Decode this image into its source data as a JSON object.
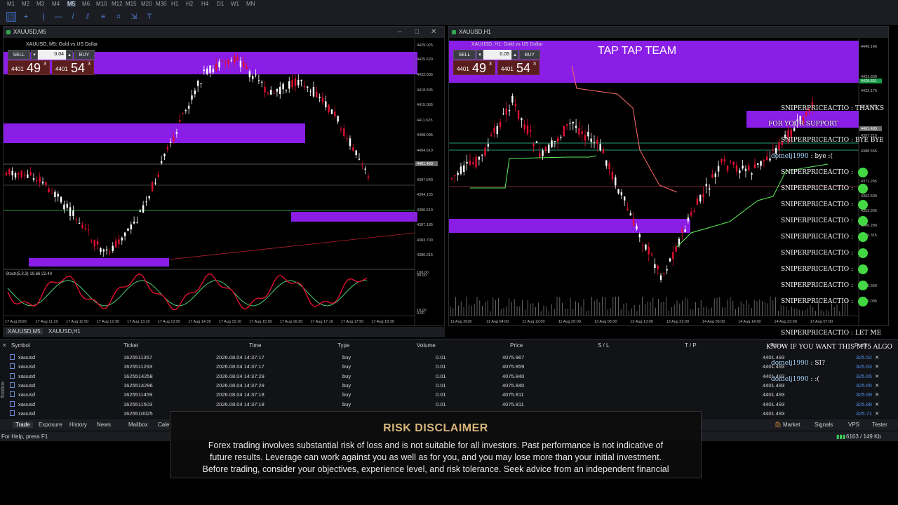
{
  "timeframes": [
    "M1",
    "M2",
    "M3",
    "M4",
    "M5",
    "M6",
    "M10",
    "M12",
    "M15",
    "M20",
    "M30",
    "H1",
    "H2",
    "H4",
    "D1",
    "W1",
    "MN"
  ],
  "active_timeframe": "M5",
  "left_chart": {
    "window_title": "XAUUSD,M5",
    "symbol_desc": "XAUUSD, M5:  Gold vs US Dollar",
    "sell_label": "SELL",
    "buy_label": "BUY",
    "lot": "0.04",
    "bid_small": "4401",
    "bid_big": "49",
    "bid_sup": "3",
    "ask_small": "4401",
    "ask_big": "54",
    "ask_sup": "3",
    "indicator_label": "Stoch(5,3,3) 19.66 22.40",
    "price_ticks": [
      "4429.025",
      "4425.620",
      "4422.035",
      "4418.505",
      "4415.065",
      "4411.625",
      "4408.095",
      "4404.610",
      "4401.493",
      "4397.640",
      "4394.155",
      "4390.519",
      "4387.185",
      "4383.700",
      "4380.215",
      "100.00",
      "90.00",
      "10.00",
      "0.00"
    ],
    "time_ticks": [
      "17 Aug 2026",
      "17 Aug 11:10",
      "17 Aug 11:50",
      "17 Aug 12:30",
      "17 Aug 13:10",
      "17 Aug 13:50",
      "17 Aug 14:30",
      "17 Aug 15:10",
      "17 Aug 15:50",
      "17 Aug 16:30",
      "17 Aug 17:10",
      "17 Aug 17:50",
      "17 Aug 18:30"
    ]
  },
  "right_chart": {
    "window_title": "XAUUSD,H1",
    "symbol_desc": "XAUUSD, H1:  Gold vs US Dollar",
    "sell_label": "SELL",
    "buy_label": "BUY",
    "lot": "0.05",
    "bid_small": "4401",
    "bid_big": "49",
    "bid_sup": "3",
    "ask_small": "4401",
    "ask_big": "54",
    "ask_sup": "3",
    "banner": "TAP TAP TEAM",
    "price_ticks": [
      "4449.140",
      "4431.830",
      "4429.651",
      "4423.175",
      "4413.335",
      "4401.493",
      "4397.210",
      "4388.555",
      "4371.245",
      "4362.590",
      "4353.935",
      "4345.280",
      "4339.315",
      "4310.660",
      "4302.005"
    ],
    "time_ticks": [
      "11 Aug 2026",
      "11 Aug 04:00",
      "11 Aug 12:00",
      "11 Aug 20:00",
      "13 Aug 05:00",
      "13 Aug 13:00",
      "13 Aug 22:00",
      "14 Aug 06:00",
      "14 Aug 14:00",
      "14 Aug 23:00",
      "17 Aug 07:00"
    ]
  },
  "chart_tabs": [
    "XAUUSD,M5",
    "XAUUSD,H1"
  ],
  "terminal": {
    "columns": [
      "Symbol",
      "Ticket",
      "Time",
      "Type",
      "Volume",
      "Price",
      "S / L",
      "T / P",
      "Price",
      "Profit"
    ],
    "rows": [
      [
        "xauusd",
        "1625511357",
        "2026.08.04 14:37:17",
        "buy",
        "0.01",
        "4075.967",
        "4401.493",
        "325.52"
      ],
      [
        "xauusd",
        "1625511293",
        "2026.08.04 14:37:17",
        "buy",
        "0.01",
        "4075.859",
        "4401.493",
        "325.63"
      ],
      [
        "xauusd",
        "1625514258",
        "2026.08.04 14:37:29",
        "buy",
        "0.01",
        "4075.840",
        "4401.493",
        "325.65"
      ],
      [
        "xauusd",
        "1625514296",
        "2026.08.04 14:37:29",
        "buy",
        "0.01",
        "4075.840",
        "4401.493",
        "325.65"
      ],
      [
        "xauusd",
        "1625511459",
        "2026.08.04 14:37:18",
        "buy",
        "0.01",
        "4075.811",
        "4401.493",
        "325.68"
      ],
      [
        "xauusd",
        "1625511503",
        "2026.08.04 14:37:18",
        "buy",
        "0.01",
        "4075.811",
        "4401.493",
        "325.68"
      ],
      [
        "xauusd",
        "1625510025",
        "",
        "",
        "",
        "",
        "4401.493",
        "325.71"
      ]
    ]
  },
  "bottom_tabs": [
    "Trade",
    "Exposure",
    "History",
    "News",
    "Mailbox",
    "Calen"
  ],
  "bottom_right_tabs": [
    "Market",
    "Signals",
    "VPS",
    "Tester"
  ],
  "toolbox_label": "Toolbox",
  "status": {
    "help": "For Help, press F1",
    "traffic": "6163 / 149 Kb"
  },
  "chat": [
    {
      "user": "SNIPERPRICEACTIO",
      "text": ": THANKS"
    },
    {
      "user": "",
      "text": "FOR YOUR SUPPORT"
    },
    {
      "user": "SNIPERPRICEACTIO",
      "text": ": BYE BYE"
    },
    {
      "user": "domelj1990",
      "text": ": bye :("
    },
    {
      "user": "SNIPERPRICEACTIO",
      "text": ":"
    },
    {
      "user": "SNIPERPRICEACTIO",
      "text": ":"
    },
    {
      "user": "SNIPERPRICEACTIO",
      "text": ":"
    },
    {
      "user": "SNIPERPRICEACTIO",
      "text": ":"
    },
    {
      "user": "SNIPERPRICEACTIO",
      "text": ":"
    },
    {
      "user": "SNIPERPRICEACTIO",
      "text": ":"
    },
    {
      "user": "SNIPERPRICEACTIO",
      "text": ":"
    },
    {
      "user": "SNIPERPRICEACTIO",
      "text": ":"
    },
    {
      "user": "SNIPERPRICEACTIO",
      "text": ":"
    },
    {
      "user": "SNIPERPRICEACTIO",
      "text": ": LET ME"
    },
    {
      "user": "",
      "text": "KNOW IF YOU WANT THIS MT5 ALGO"
    },
    {
      "user": "domelj1990",
      "text": ": SI?"
    },
    {
      "user": "domelj1990",
      "text": ": :("
    }
  ],
  "disclaimer": {
    "title": "RISK DISCLAIMER",
    "line1": "Forex trading involves substantial risk of loss and is not suitable for all investors. Past performance is not indicative of",
    "line2": "future results. Leverage can work against you as well as for you, and you may lose more than your initial investment.",
    "line3": "Before trading, consider your objectives, experience level, and risk tolerance. Seek advice from an independent financial"
  },
  "colors": {
    "zone": "#8a1ee6",
    "bull": "#ffffff",
    "bear": "#e01030",
    "stoch_k": "#e01030",
    "stoch_d": "#4fd07a",
    "trail_green": "#5ef05e",
    "trail_red": "#ff6a6a"
  }
}
